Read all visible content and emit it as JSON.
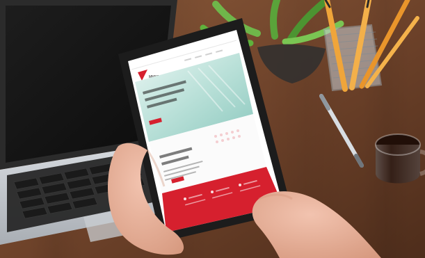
{
  "colors": {
    "desk": "#7a4a2c",
    "desk_dark": "#5b3520",
    "laptop_body": "#bfc3c7",
    "laptop_screen": "#151515",
    "keyboard": "#2a2a2a",
    "tablet_bezel": "#1c1c1c",
    "website_red": "#d6202e",
    "website_white": "#ffffff",
    "glass_tint": "#c9e7e2",
    "coffee": "#2a140b",
    "plant_green": "#5aa33a",
    "pencil_yellow": "#f0a53a",
    "skin": "#e7b19a"
  },
  "objects": {
    "laptop": "laptop",
    "tablet": "tablet",
    "plant": "plant",
    "pencil_holder": "pencil-holder",
    "pen": "pen",
    "coffee_cup": "coffee-cup",
    "hands": "hands"
  }
}
